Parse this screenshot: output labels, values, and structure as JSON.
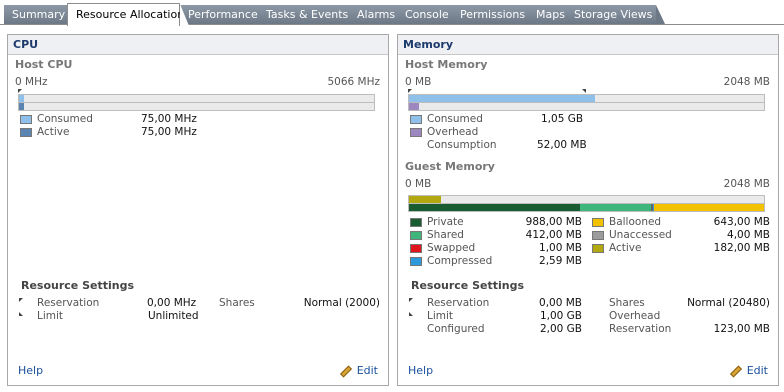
{
  "tabs": [
    "Summary",
    "Resource Allocation",
    "Performance",
    "Tasks & Events",
    "Alarms",
    "Console",
    "Permissions",
    "Maps",
    "Storage Views"
  ],
  "cpu": {
    "title": "CPU",
    "host_title": "Host CPU",
    "axis_min": "0 MHz",
    "axis_max": "5066 MHz",
    "legend": [
      {
        "label": "Consumed",
        "value": "75,00 MHz",
        "color": "#8fc0ea"
      },
      {
        "label": "Active",
        "value": "75,00 MHz",
        "color": "#5b84b3"
      }
    ],
    "consumed_fraction": 0.015,
    "resource_title": "Resource Settings",
    "reservation_label": "Reservation",
    "reservation_value": "0,00 MHz",
    "limit_label": "Limit",
    "limit_value": "Unlimited",
    "shares_label": "Shares",
    "shares_value": "Normal (2000)",
    "help": "Help",
    "edit": "Edit"
  },
  "memory": {
    "title": "Memory",
    "host_title": "Host Memory",
    "axis_min": "0 MB",
    "axis_max": "2048 MB",
    "host_legend": [
      {
        "label": "Consumed",
        "value": "1,05 GB",
        "color": "#8fc0ea"
      },
      {
        "label": "Overhead",
        "value": "",
        "color": "#9d87bf"
      },
      {
        "label": "Consumption",
        "value": "52,00 MB",
        "color": ""
      }
    ],
    "host_consumed_fraction": 0.525,
    "guest_title": "Guest Memory",
    "guest_axis_min": "0 MB",
    "guest_axis_max": "2048 MB",
    "guest_legend_left": [
      {
        "label": "Private",
        "value": "988,00 MB",
        "color": "#1a5c31"
      },
      {
        "label": "Shared",
        "value": "412,00 MB",
        "color": "#3eb57a"
      },
      {
        "label": "Swapped",
        "value": "1,00 MB",
        "color": "#e0141c"
      },
      {
        "label": "Compressed",
        "value": "2,59 MB",
        "color": "#2d98dc"
      }
    ],
    "guest_legend_right": [
      {
        "label": "Ballooned",
        "value": "643,00 MB",
        "color": "#f2c200"
      },
      {
        "label": "Unaccessed",
        "value": "4,00 MB",
        "color": "#9c9c9c"
      },
      {
        "label": "Active",
        "value": "182,00 MB",
        "color": "#b2a811"
      }
    ],
    "guest_active_fraction": 0.089,
    "guest_segments": [
      {
        "name": "private",
        "fraction": 0.482,
        "color": "#1a5c31"
      },
      {
        "name": "shared",
        "fraction": 0.201,
        "color": "#3eb57a"
      },
      {
        "name": "unaccessed",
        "fraction": 0.004,
        "color": "#666666"
      },
      {
        "name": "compressed",
        "fraction": 0.004,
        "color": "#2d98dc"
      },
      {
        "name": "ballooned",
        "fraction": 0.309,
        "color": "#f2c200"
      }
    ],
    "resource_title": "Resource Settings",
    "reservation_label": "Reservation",
    "reservation_value": "0,00 MB",
    "limit_label": "Limit",
    "limit_value": "1,00 GB",
    "configured_label": "Configured",
    "configured_value": "2,00 GB",
    "shares_label": "Shares",
    "shares_value": "Normal (20480)",
    "overhead_label": "Overhead",
    "overhead_value": "",
    "reservation2_label": "Reservation",
    "reservation2_value": "123,00 MB",
    "help": "Help",
    "edit": "Edit"
  }
}
